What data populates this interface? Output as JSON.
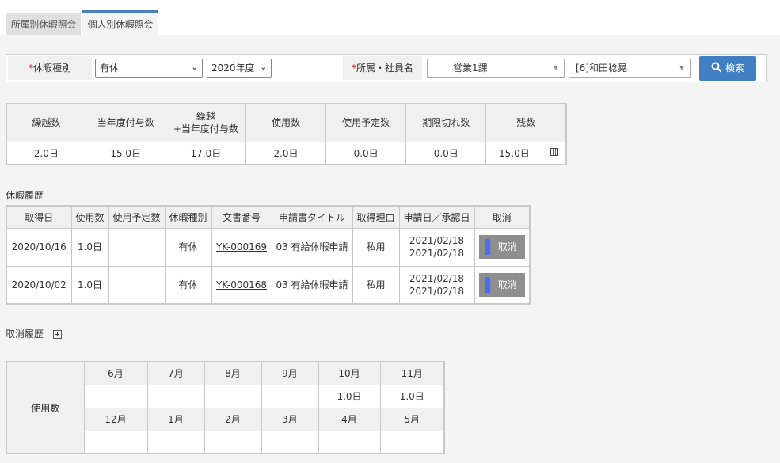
{
  "tabs": [
    "所属別休暇照会",
    "個人別休暇照会"
  ],
  "filter": {
    "leave_type_label": "休暇種別",
    "leave_type_value": "有休",
    "year_value": "2020年度",
    "dept_label": "所属・社員名",
    "dept_value": "営業1課",
    "employee_value": "[6]和田稔晃",
    "search_label": "検索",
    "required_mark": "*"
  },
  "summary": {
    "headers": [
      "繰越数",
      "当年度付与数",
      "繰越\n+当年度付与数",
      "使用数",
      "使用予定数",
      "期限切れ数",
      "残数"
    ],
    "values": [
      "2.0日",
      "15.0日",
      "17.0日",
      "2.0日",
      "0.0日",
      "0.0日",
      "15.0日"
    ]
  },
  "history": {
    "title": "休暇履歴",
    "headers": [
      "取得日",
      "使用数",
      "使用予定数",
      "休暇種別",
      "文書番号",
      "申請書タイトル",
      "取得理由",
      "申請日／承認日",
      "取消"
    ],
    "rows": [
      {
        "date": "2020/10/16",
        "used": "1.0日",
        "planned": "",
        "type": "有休",
        "doc": "YK-000169",
        "title": "03 有給休暇申請",
        "reason": "私用",
        "applied": "2021/02/18",
        "approved": "2021/02/18",
        "cancel": "取消"
      },
      {
        "date": "2020/10/02",
        "used": "1.0日",
        "planned": "",
        "type": "有休",
        "doc": "YK-000168",
        "title": "03 有給休暇申請",
        "reason": "私用",
        "applied": "2021/02/18",
        "approved": "2021/02/18",
        "cancel": "取消"
      }
    ]
  },
  "cancel_history": {
    "title": "取消履歴"
  },
  "monthly": {
    "row_label": "使用数",
    "months_top": [
      "6月",
      "7月",
      "8月",
      "9月",
      "10月",
      "11月"
    ],
    "values_top": [
      "",
      "",
      "",
      "",
      "1.0日",
      "1.0日"
    ],
    "months_bottom": [
      "12月",
      "1月",
      "2月",
      "3月",
      "4月",
      "5月"
    ],
    "values_bottom": [
      "",
      "",
      "",
      "",
      "",
      ""
    ]
  }
}
